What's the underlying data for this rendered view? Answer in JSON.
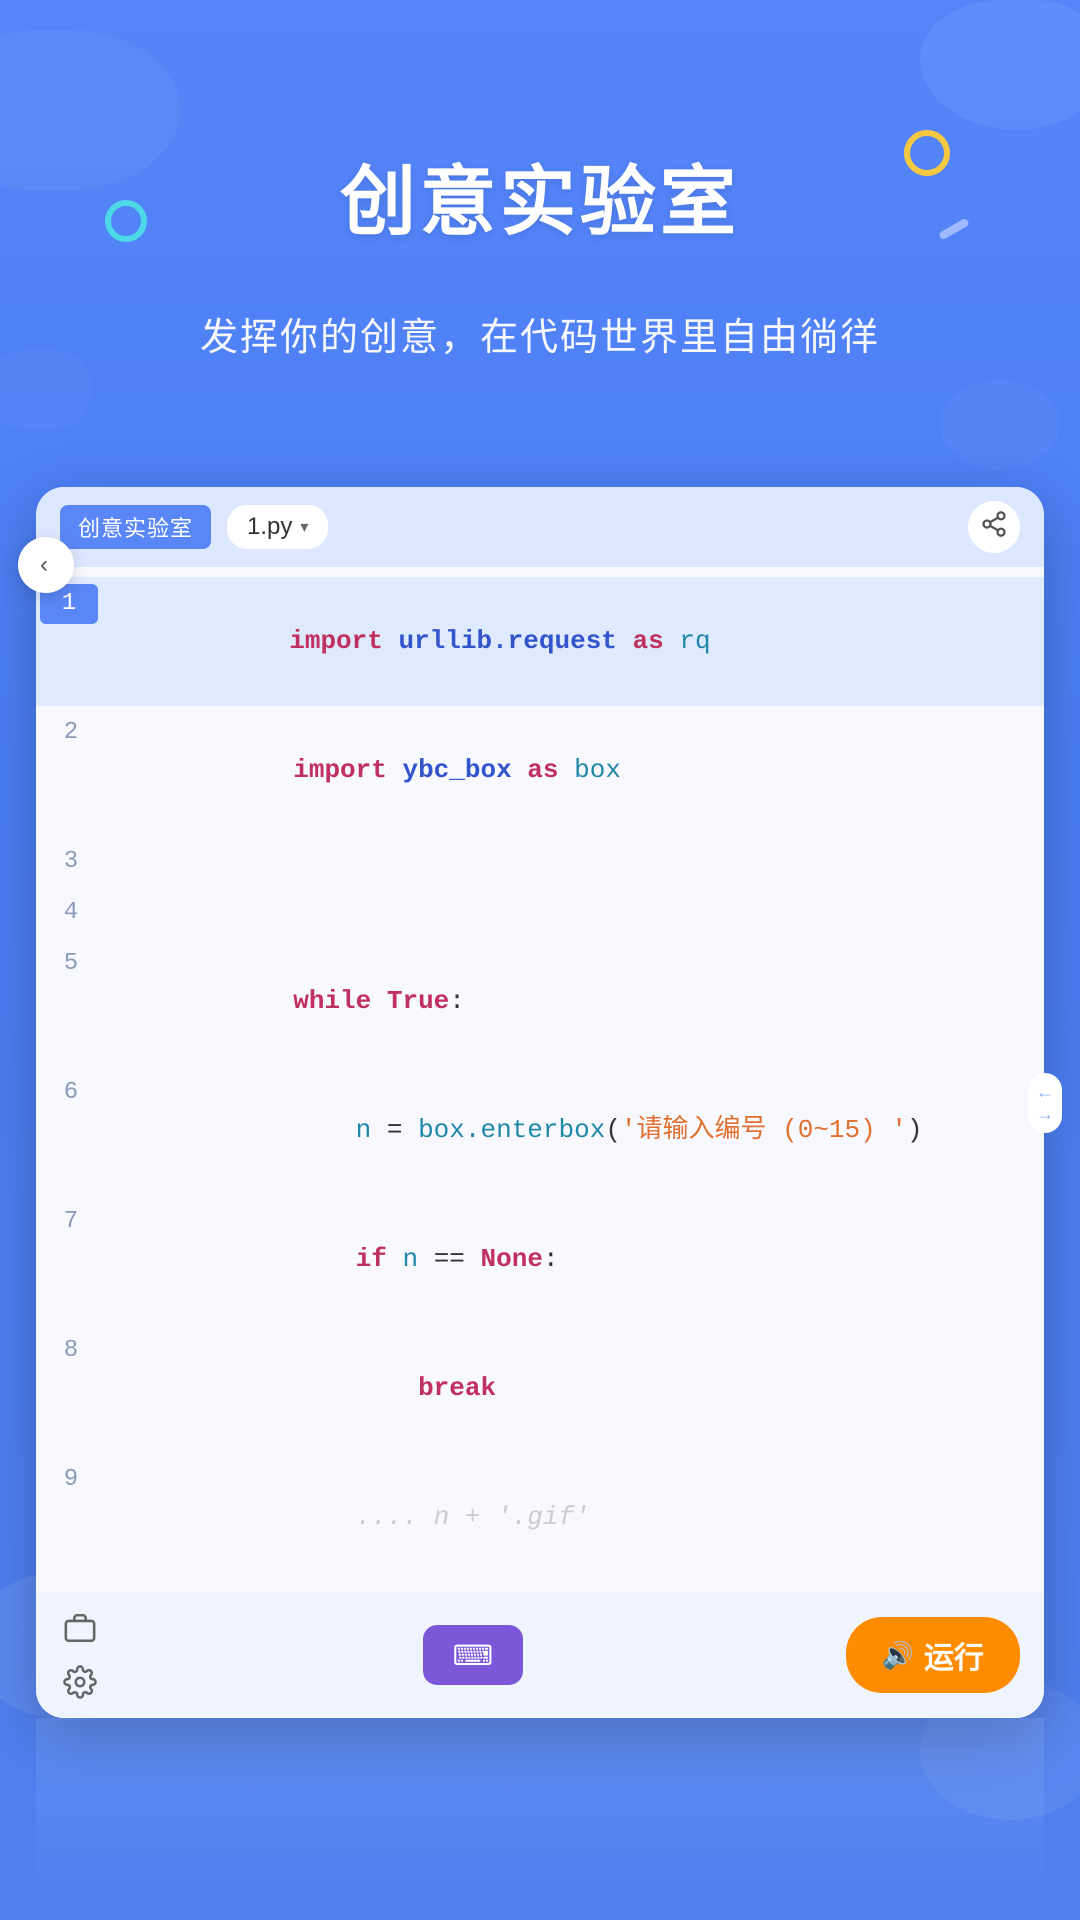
{
  "page": {
    "title": "创意实验室",
    "subtitle": "发挥你的创意，在代码世界里自由徜徉"
  },
  "editor": {
    "tab_label": "创意实验室",
    "file_name": "1.py",
    "back_icon": "‹",
    "share_icon": "⬆",
    "keyboard_icon": "⌨",
    "run_label": "运行",
    "run_icon": "🔊",
    "scroll_icon": "⇌"
  },
  "code": {
    "lines": [
      {
        "num": "1",
        "content": "import urllib.request as rq",
        "highlighted": true
      },
      {
        "num": "2",
        "content": "import ybc_box as box",
        "highlighted": false
      },
      {
        "num": "3",
        "content": "",
        "highlighted": false
      },
      {
        "num": "4",
        "content": "",
        "highlighted": false
      },
      {
        "num": "5",
        "content": "while True:",
        "highlighted": false
      },
      {
        "num": "6",
        "content": "    n = box.enterbox('请输入编号 (0~15) ')",
        "highlighted": false
      },
      {
        "num": "7",
        "content": "    if n == None:",
        "highlighted": false
      },
      {
        "num": "8",
        "content": "        break",
        "highlighted": false
      },
      {
        "num": "9",
        "content": "    ...",
        "highlighted": false
      }
    ]
  },
  "decorations": {
    "teal_circle": "○",
    "yellow_circle": "○",
    "code_brackets": "</>",
    "dash": "—"
  }
}
